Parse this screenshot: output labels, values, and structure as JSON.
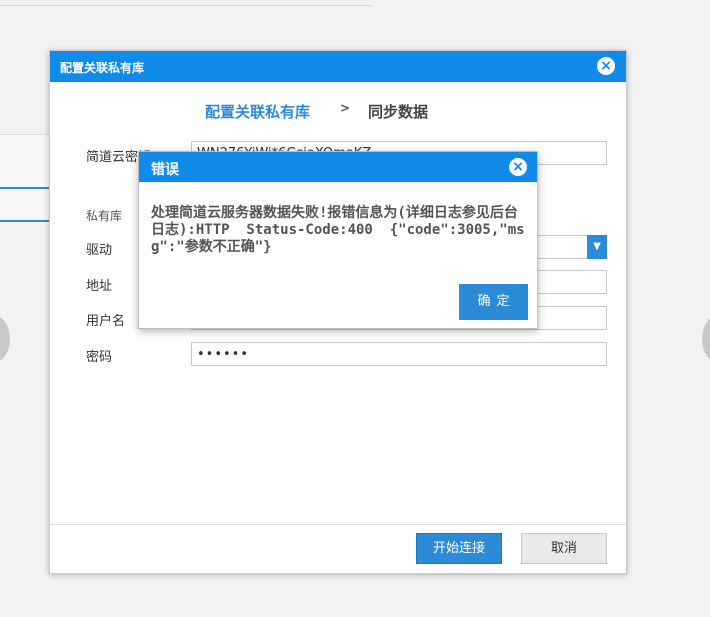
{
  "main_dialog": {
    "title": "配置关联私有库",
    "close_icon": "×",
    "steps": {
      "active": "配置关联私有库",
      "separator": ">",
      "next": "同步数据"
    },
    "form": {
      "key_label": "简道云密钥",
      "key_value": "WN276YiWi*6GsiaXOmaKZ",
      "section_label": "私有库",
      "driver_label": "驱动",
      "driver_value": "",
      "address_label": "地址",
      "address_value": "",
      "username_label": "用户名",
      "username_value": "",
      "password_label": "密码",
      "password_value": "••••••"
    },
    "buttons": {
      "connect": "开始连接",
      "cancel": "取消"
    }
  },
  "error_dialog": {
    "title": "错误",
    "close_icon": "×",
    "message": "处理简道云服务器数据失败!报错信息为(详细日志参见后台日志):HTTP  Status-Code:400  {\"code\":3005,\"msg\":\"参数不正确\"}",
    "ok_label": "确定"
  },
  "colors": {
    "header_blue": "#118bea",
    "accent_blue": "#2b8bd6"
  }
}
